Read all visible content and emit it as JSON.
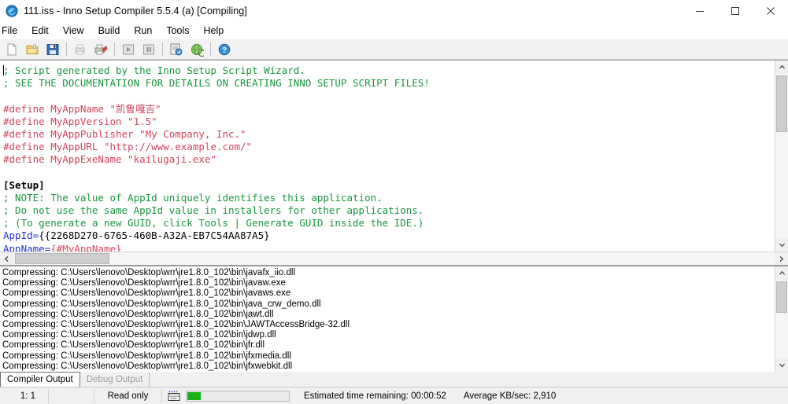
{
  "window": {
    "title": "111.iss - Inno Setup Compiler 5.5.4 (a)  [Compiling]",
    "icon": "inno-setup-logo-icon",
    "minimize_label": "—",
    "maximize_label": "□",
    "close_label": "✕"
  },
  "menu": {
    "items": [
      {
        "label": "File"
      },
      {
        "label": "Edit"
      },
      {
        "label": "View"
      },
      {
        "label": "Build"
      },
      {
        "label": "Run"
      },
      {
        "label": "Tools"
      },
      {
        "label": "Help"
      }
    ]
  },
  "toolbar": {
    "buttons": [
      {
        "name": "new-file-icon",
        "tip": "New"
      },
      {
        "name": "open-folder-icon",
        "tip": "Open"
      },
      {
        "name": "save-floppy-icon",
        "tip": "Save"
      },
      {
        "name": "print-preview-icon",
        "tip": "Print Preview"
      },
      {
        "name": "print-icon",
        "tip": "Print"
      },
      {
        "name": "run-play-icon",
        "tip": "Run"
      },
      {
        "name": "pause-icon",
        "tip": "Pause"
      },
      {
        "name": "compile-icon",
        "tip": "Compile"
      },
      {
        "name": "globe-icon",
        "tip": "Inno Setup on the Web"
      },
      {
        "name": "help-question-icon",
        "tip": "Help"
      }
    ]
  },
  "editor": {
    "lines": [
      {
        "type": "comment",
        "text": "; Script generated by the Inno Setup Script Wizard.",
        "caret": true
      },
      {
        "type": "comment",
        "text": "; SEE THE DOCUMENTATION FOR DETAILS ON CREATING INNO SETUP SCRIPT FILES!"
      },
      {
        "type": "blank",
        "text": ""
      },
      {
        "type": "define",
        "text": "#define MyAppName \"凯鲁嘎吉\""
      },
      {
        "type": "define",
        "text": "#define MyAppVersion \"1.5\""
      },
      {
        "type": "define",
        "text": "#define MyAppPublisher \"My Company, Inc.\""
      },
      {
        "type": "define",
        "text": "#define MyAppURL \"http://www.example.com/\""
      },
      {
        "type": "define",
        "text": "#define MyAppExeName \"kailugaji.exe\""
      },
      {
        "type": "blank",
        "text": ""
      },
      {
        "type": "section",
        "text": "[Setup]"
      },
      {
        "type": "comment",
        "text": "; NOTE: The value of AppId uniquely identifies this application."
      },
      {
        "type": "comment",
        "text": "; Do not use the same AppId value in installers for other applications."
      },
      {
        "type": "comment",
        "text": "; (To generate a new GUID, click Tools | Generate GUID inside the IDE.)"
      },
      {
        "type": "keyvalue",
        "key": "AppId=",
        "value": "{{2268D270-6765-460B-A32A-EB7C54AA87A5}"
      },
      {
        "type": "keymacro",
        "key": "AppName=",
        "value": "{#MyAppName}"
      }
    ]
  },
  "output": {
    "lines": [
      "Compressing: C:\\Users\\lenovo\\Desktop\\wrr\\jre1.8.0_102\\bin\\javafx_iio.dll",
      "Compressing: C:\\Users\\lenovo\\Desktop\\wrr\\jre1.8.0_102\\bin\\javaw.exe",
      "Compressing: C:\\Users\\lenovo\\Desktop\\wrr\\jre1.8.0_102\\bin\\javaws.exe",
      "Compressing: C:\\Users\\lenovo\\Desktop\\wrr\\jre1.8.0_102\\bin\\java_crw_demo.dll",
      "Compressing: C:\\Users\\lenovo\\Desktop\\wrr\\jre1.8.0_102\\bin\\jawt.dll",
      "Compressing: C:\\Users\\lenovo\\Desktop\\wrr\\jre1.8.0_102\\bin\\JAWTAccessBridge-32.dll",
      "Compressing: C:\\Users\\lenovo\\Desktop\\wrr\\jre1.8.0_102\\bin\\jdwp.dll",
      "Compressing: C:\\Users\\lenovo\\Desktop\\wrr\\jre1.8.0_102\\bin\\jfr.dll",
      "Compressing: C:\\Users\\lenovo\\Desktop\\wrr\\jre1.8.0_102\\bin\\jfxmedia.dll",
      "Compressing: C:\\Users\\lenovo\\Desktop\\wrr\\jre1.8.0_102\\bin\\jfxwebkit.dll"
    ]
  },
  "tabs": {
    "items": [
      {
        "label": "Compiler Output",
        "active": true
      },
      {
        "label": "Debug Output",
        "active": false
      }
    ]
  },
  "statusbar": {
    "position": "1:  1",
    "mode": "Read only",
    "keyboard_icon": "keyboard-icon",
    "progress_percent": 13,
    "eta": "Estimated time remaining: 00:00:52",
    "rate": "Average KB/sec: 2,910"
  },
  "colors": {
    "comment": "#1a9641",
    "define": "#d4455f",
    "key": "#2233cc",
    "progress": "#16b216",
    "toolbar_bg": "#f2f2f2"
  }
}
